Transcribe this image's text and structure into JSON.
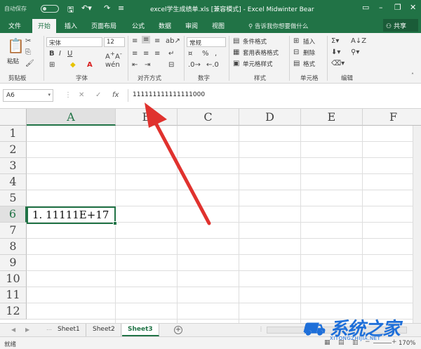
{
  "titlebar": {
    "autosave_label": "自动保存",
    "toggle_state": "关",
    "title": "excel学生成绩单.xls  [兼容模式]  -  Excel    Midwinter Bear"
  },
  "ribbon_tabs": [
    "文件",
    "开始",
    "插入",
    "页面布局",
    "公式",
    "数据",
    "审阅",
    "视图"
  ],
  "active_tab": "开始",
  "tell_me": "告诉我你想要做什么",
  "share_label": "共享",
  "ribbon": {
    "clipboard": {
      "paste": "粘贴",
      "label": "剪贴板"
    },
    "font": {
      "name": "宋体",
      "size": "12",
      "label": "字体"
    },
    "alignment": {
      "label": "对齐方式"
    },
    "number": {
      "format": "常规",
      "label": "数字"
    },
    "styles": {
      "conditional": "条件格式",
      "table": "套用表格格式",
      "cell": "单元格样式",
      "label": "样式"
    },
    "cells": {
      "insert": "插入",
      "delete": "删除",
      "format": "格式",
      "label": "单元格"
    },
    "editing": {
      "label": "编辑"
    }
  },
  "formula_bar": {
    "name_box": "A6",
    "cancel_symbol": "✕",
    "enter_symbol": "✓",
    "fx_symbol": "fx",
    "formula": "111111111111111000"
  },
  "grid": {
    "columns": [
      "A",
      "B",
      "C",
      "D",
      "E",
      "F"
    ],
    "rows": [
      "1",
      "2",
      "3",
      "4",
      "5",
      "6",
      "7",
      "8",
      "9",
      "10",
      "11",
      "12"
    ],
    "selected_column": "A",
    "selected_row": "6",
    "active_cell_value": "1. 11111E+17"
  },
  "sheets": [
    "Sheet1",
    "Sheet2",
    "Sheet3"
  ],
  "active_sheet": "Sheet3",
  "status": {
    "text": "就绪",
    "zoom": "170%"
  },
  "watermark": {
    "logo": "系统之家",
    "url": "XITONGZHIJIA.NET"
  },
  "colors": {
    "accent": "#217346",
    "arrow": "#e0322e"
  }
}
